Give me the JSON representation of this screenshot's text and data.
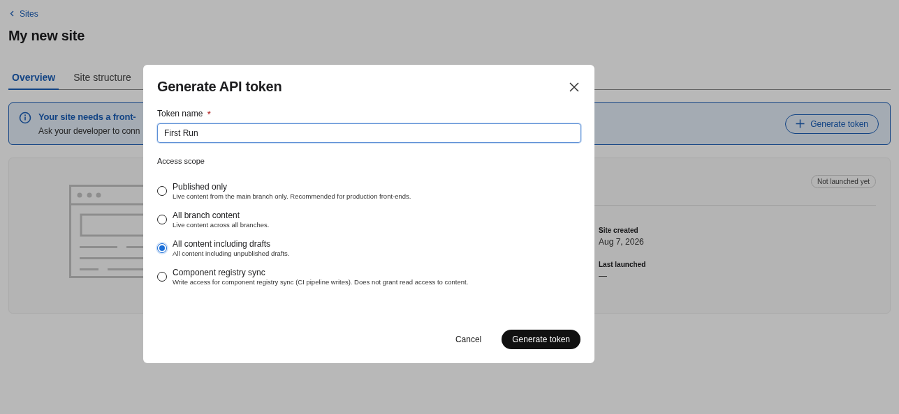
{
  "breadcrumb": {
    "label": "Sites"
  },
  "page_title": "My new site",
  "tabs": [
    {
      "label": "Overview",
      "selected": true
    },
    {
      "label": "Site structure",
      "selected": false
    }
  ],
  "banner": {
    "title": "Your site needs a front-",
    "text": "Ask your developer to conn",
    "button": "Generate token"
  },
  "site_card": {
    "status": "Not launched yet",
    "details": [
      {
        "label": "Site created",
        "value": "Aug 7, 2026"
      },
      {
        "label": "Last launched",
        "value": "—"
      }
    ]
  },
  "dialog": {
    "title": "Generate API token",
    "token_field": {
      "label": "Token name",
      "required_mark": "*",
      "value": "First Run"
    },
    "scope_label": "Access scope",
    "scopes": [
      {
        "label": "Published only",
        "description": "Live content from the main branch only. Recommended for production front-ends.",
        "selected": false
      },
      {
        "label": "All branch content",
        "description": "Live content across all branches.",
        "selected": false
      },
      {
        "label": "All content including drafts",
        "description": "All content including unpublished drafts.",
        "selected": true
      },
      {
        "label": "Component registry sync",
        "description": "Write access for component registry sync (CI pipeline writes). Does not grant read access to content.",
        "selected": false
      }
    ],
    "buttons": [
      {
        "kind": "secondary",
        "label": "Cancel"
      },
      {
        "kind": "primary",
        "label": "Generate token"
      }
    ]
  }
}
